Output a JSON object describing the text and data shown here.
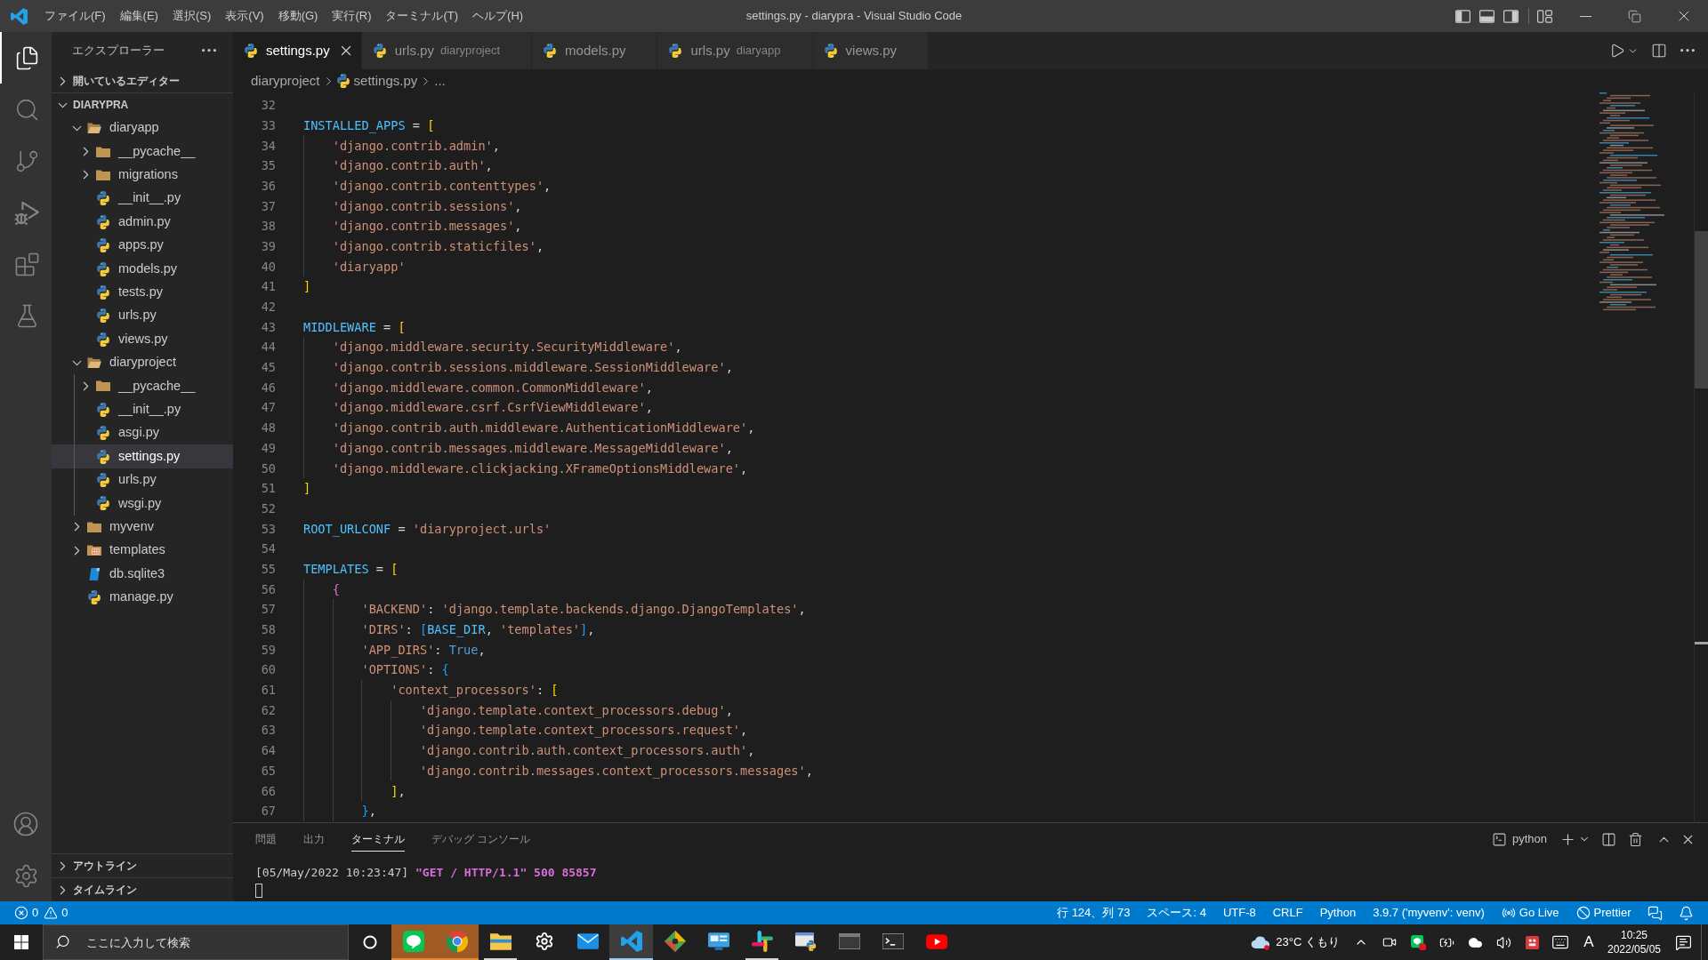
{
  "window": {
    "title": "settings.py - diarypra - Visual Studio Code"
  },
  "menu": [
    "ファイル(F)",
    "編集(E)",
    "選択(S)",
    "表示(V)",
    "移動(G)",
    "実行(R)",
    "ターミナル(T)",
    "ヘルプ(H)"
  ],
  "activity_bar": {
    "items": [
      {
        "kind": "explorer",
        "selected": true
      },
      {
        "kind": "search",
        "selected": false
      },
      {
        "kind": "source-control",
        "selected": false
      },
      {
        "kind": "run-debug",
        "selected": false
      },
      {
        "kind": "extensions",
        "selected": false
      },
      {
        "kind": "testing",
        "selected": false
      }
    ]
  },
  "sidebar": {
    "title": "エクスプローラー",
    "sections": [
      {
        "title": "開いているエディター",
        "expanded": false
      },
      {
        "title": "DIARYPRA",
        "expanded": true,
        "children": [
          {
            "label": "diaryapp",
            "kind": "folder",
            "expanded": true,
            "selected": false,
            "children": [
              {
                "label": "__pycache__",
                "kind": "folder",
                "expanded": false,
                "selected": false
              },
              {
                "label": "migrations",
                "kind": "folder",
                "expanded": false,
                "selected": false
              },
              {
                "label": "__init__.py",
                "kind": "python",
                "selected": false
              },
              {
                "label": "admin.py",
                "kind": "python",
                "selected": false
              },
              {
                "label": "apps.py",
                "kind": "python",
                "selected": false
              },
              {
                "label": "models.py",
                "kind": "python",
                "selected": false
              },
              {
                "label": "tests.py",
                "kind": "python",
                "selected": false
              },
              {
                "label": "urls.py",
                "kind": "python",
                "selected": false
              },
              {
                "label": "views.py",
                "kind": "python",
                "selected": false
              }
            ]
          },
          {
            "label": "diaryproject",
            "kind": "folder",
            "expanded": true,
            "selected": false,
            "children": [
              {
                "label": "__pycache__",
                "kind": "folder",
                "expanded": false,
                "selected": false
              },
              {
                "label": "__init__.py",
                "kind": "python",
                "selected": false
              },
              {
                "label": "asgi.py",
                "kind": "python",
                "selected": false
              },
              {
                "label": "settings.py",
                "kind": "python",
                "selected": true
              },
              {
                "label": "urls.py",
                "kind": "python",
                "selected": false
              },
              {
                "label": "wsgi.py",
                "kind": "python",
                "selected": false
              }
            ]
          },
          {
            "label": "myvenv",
            "kind": "folder",
            "expanded": false,
            "selected": false
          },
          {
            "label": "templates",
            "kind": "template-folder",
            "expanded": false,
            "selected": false
          },
          {
            "label": "db.sqlite3",
            "kind": "database",
            "selected": false
          },
          {
            "label": "manage.py",
            "kind": "python",
            "selected": false
          }
        ]
      },
      {
        "title": "アウトライン",
        "expanded": false
      },
      {
        "title": "タイムライン",
        "expanded": false
      }
    ]
  },
  "tabs": [
    {
      "label": "settings.py",
      "selected": true
    },
    {
      "label": "urls.py",
      "description": "diaryproject",
      "selected": false
    },
    {
      "label": "models.py",
      "selected": false
    },
    {
      "label": "urls.py",
      "description": "diaryapp",
      "selected": false
    },
    {
      "label": "views.py",
      "selected": false
    }
  ],
  "breadcrumbs": [
    {
      "label": "diaryproject",
      "kind": "folder"
    },
    {
      "label": "settings.py",
      "kind": "python"
    },
    {
      "label": "...",
      "kind": "symbol"
    }
  ],
  "editor": {
    "lines": [
      {
        "number": "32"
      },
      {
        "number": "33",
        "tokens": [
          {
            "kind": "constant",
            "text": "INSTALLED_APPS"
          },
          {
            "kind": "punct",
            "text": " = "
          },
          {
            "kind": "open",
            "text": "["
          }
        ]
      },
      {
        "number": "34",
        "tokens": [
          {
            "kind": "string",
            "text": "    'django.contrib.admin'"
          },
          {
            "kind": "punct",
            "text": ","
          }
        ]
      },
      {
        "number": "35",
        "tokens": [
          {
            "kind": "string",
            "text": "    'django.contrib.auth'"
          },
          {
            "kind": "punct",
            "text": ","
          }
        ]
      },
      {
        "number": "36",
        "tokens": [
          {
            "kind": "string",
            "text": "    'django.contrib.contenttypes'"
          },
          {
            "kind": "punct",
            "text": ","
          }
        ]
      },
      {
        "number": "37",
        "tokens": [
          {
            "kind": "string",
            "text": "    'django.contrib.sessions'"
          },
          {
            "kind": "punct",
            "text": ","
          }
        ]
      },
      {
        "number": "38",
        "tokens": [
          {
            "kind": "string",
            "text": "    'django.contrib.messages'"
          },
          {
            "kind": "punct",
            "text": ","
          }
        ]
      },
      {
        "number": "39",
        "tokens": [
          {
            "kind": "string",
            "text": "    'django.contrib.staticfiles'"
          },
          {
            "kind": "punct",
            "text": ","
          }
        ]
      },
      {
        "number": "40",
        "tokens": [
          {
            "kind": "string",
            "text": "    'diaryapp'"
          }
        ]
      },
      {
        "number": "41",
        "tokens": [
          {
            "kind": "close",
            "text": "]"
          }
        ]
      },
      {
        "number": "42"
      },
      {
        "number": "43",
        "tokens": [
          {
            "kind": "constant",
            "text": "MIDDLEWARE"
          },
          {
            "kind": "punct",
            "text": " = "
          },
          {
            "kind": "open",
            "text": "["
          }
        ]
      },
      {
        "number": "44",
        "tokens": [
          {
            "kind": "string",
            "text": "    'django.middleware.security.SecurityMiddleware'"
          },
          {
            "kind": "punct",
            "text": ","
          }
        ]
      },
      {
        "number": "45",
        "tokens": [
          {
            "kind": "string",
            "text": "    'django.contrib.sessions.middleware.SessionMiddleware'"
          },
          {
            "kind": "punct",
            "text": ","
          }
        ]
      },
      {
        "number": "46",
        "tokens": [
          {
            "kind": "string",
            "text": "    'django.middleware.common.CommonMiddleware'"
          },
          {
            "kind": "punct",
            "text": ","
          }
        ]
      },
      {
        "number": "47",
        "tokens": [
          {
            "kind": "string",
            "text": "    'django.middleware.csrf.CsrfViewMiddleware'"
          },
          {
            "kind": "punct",
            "text": ","
          }
        ]
      },
      {
        "number": "48",
        "tokens": [
          {
            "kind": "string",
            "text": "    'django.contrib.auth.middleware.AuthenticationMiddleware'"
          },
          {
            "kind": "punct",
            "text": ","
          }
        ]
      },
      {
        "number": "49",
        "tokens": [
          {
            "kind": "string",
            "text": "    'django.contrib.messages.middleware.MessageMiddleware'"
          },
          {
            "kind": "punct",
            "text": ","
          }
        ]
      },
      {
        "number": "50",
        "tokens": [
          {
            "kind": "string",
            "text": "    'django.middleware.clickjacking.XFrameOptionsMiddleware'"
          },
          {
            "kind": "punct",
            "text": ","
          }
        ]
      },
      {
        "number": "51",
        "tokens": [
          {
            "kind": "close",
            "text": "]"
          }
        ]
      },
      {
        "number": "52"
      },
      {
        "number": "53",
        "tokens": [
          {
            "kind": "constant",
            "text": "ROOT_URLCONF"
          },
          {
            "kind": "punct",
            "text": " = "
          },
          {
            "kind": "string",
            "text": "'diaryproject.urls'"
          }
        ]
      },
      {
        "number": "54"
      },
      {
        "number": "55",
        "tokens": [
          {
            "kind": "constant",
            "text": "TEMPLATES"
          },
          {
            "kind": "punct",
            "text": " = "
          },
          {
            "kind": "open",
            "text": "["
          }
        ]
      },
      {
        "number": "56",
        "tokens": [
          {
            "kind": "open",
            "text": "    {"
          }
        ]
      },
      {
        "number": "57",
        "tokens": [
          {
            "kind": "string",
            "text": "        'BACKEND'"
          },
          {
            "kind": "punct",
            "text": ": "
          },
          {
            "kind": "string",
            "text": "'django.template.backends.django.DjangoTemplates'"
          },
          {
            "kind": "punct",
            "text": ","
          }
        ]
      },
      {
        "number": "58",
        "tokens": [
          {
            "kind": "string",
            "text": "        'DIRS'"
          },
          {
            "kind": "punct",
            "text": ": "
          },
          {
            "kind": "open",
            "text": "["
          },
          {
            "kind": "constant",
            "text": "BASE_DIR"
          },
          {
            "kind": "punct",
            "text": ", "
          },
          {
            "kind": "string",
            "text": "'templates'"
          },
          {
            "kind": "close",
            "text": "]"
          },
          {
            "kind": "punct",
            "text": ","
          }
        ]
      },
      {
        "number": "59",
        "tokens": [
          {
            "kind": "string",
            "text": "        'APP_DIRS'"
          },
          {
            "kind": "punct",
            "text": ": "
          },
          {
            "kind": "keyword",
            "text": "True"
          },
          {
            "kind": "punct",
            "text": ","
          }
        ]
      },
      {
        "number": "60",
        "tokens": [
          {
            "kind": "string",
            "text": "        'OPTIONS'"
          },
          {
            "kind": "punct",
            "text": ": "
          },
          {
            "kind": "open",
            "text": "{"
          }
        ]
      },
      {
        "number": "61",
        "tokens": [
          {
            "kind": "string",
            "text": "            'context_processors'"
          },
          {
            "kind": "punct",
            "text": ": "
          },
          {
            "kind": "open",
            "text": "["
          }
        ]
      },
      {
        "number": "62",
        "tokens": [
          {
            "kind": "string",
            "text": "                'django.template.context_processors.debug'"
          },
          {
            "kind": "punct",
            "text": ","
          }
        ]
      },
      {
        "number": "63",
        "tokens": [
          {
            "kind": "string",
            "text": "                'django.template.context_processors.request'"
          },
          {
            "kind": "punct",
            "text": ","
          }
        ]
      },
      {
        "number": "64",
        "tokens": [
          {
            "kind": "string",
            "text": "                'django.contrib.auth.context_processors.auth'"
          },
          {
            "kind": "punct",
            "text": ","
          }
        ]
      },
      {
        "number": "65",
        "tokens": [
          {
            "kind": "string",
            "text": "                'django.contrib.messages.context_processors.messages'"
          },
          {
            "kind": "punct",
            "text": ","
          }
        ]
      },
      {
        "number": "66",
        "tokens": [
          {
            "kind": "close",
            "text": "            ]"
          },
          {
            "kind": "punct",
            "text": ","
          }
        ]
      },
      {
        "number": "67",
        "tokens": [
          {
            "kind": "close",
            "text": "        }"
          },
          {
            "kind": "punct",
            "text": ","
          }
        ]
      }
    ]
  },
  "panel": {
    "tabs": [
      {
        "label": "問題",
        "selected": false
      },
      {
        "label": "出力",
        "selected": false
      },
      {
        "label": "ターミナル",
        "selected": true
      },
      {
        "label": "デバッグ コンソール",
        "selected": false
      }
    ],
    "terminal_profile": "python",
    "terminal": {
      "lines": [
        {
          "segments": [
            {
              "kind": "plain",
              "text": "[05/May/2022 10:23:47] "
            },
            {
              "kind": "magenta",
              "text": "\"GET / HTTP/1.1\" 500 85857"
            }
          ]
        }
      ]
    }
  },
  "status_bar": {
    "problems": {
      "errors": "0",
      "warnings": "0"
    },
    "items": [
      {
        "kind": "text",
        "label": "行 124、列 73"
      },
      {
        "kind": "text",
        "label": "スペース: 4"
      },
      {
        "kind": "text",
        "label": "UTF-8"
      },
      {
        "kind": "text",
        "label": "CRLF"
      },
      {
        "kind": "text",
        "label": "Python"
      },
      {
        "kind": "text",
        "label": "3.9.7 ('myvenv': venv)"
      },
      {
        "kind": "live",
        "label": "Go Live"
      },
      {
        "kind": "prettier",
        "label": "Prettier"
      }
    ]
  },
  "taskbar": {
    "search": {
      "placeholder": "ここに入力して検索"
    },
    "apps": [
      {
        "kind": "chat",
        "flashing": true,
        "selected": false,
        "running": true
      },
      {
        "kind": "browser",
        "flashing": true,
        "selected": false,
        "running": true
      },
      {
        "kind": "files",
        "flashing": false,
        "selected": false,
        "running": true
      },
      {
        "kind": "gear",
        "flashing": false,
        "selected": false,
        "running": false
      },
      {
        "kind": "mail",
        "flashing": false,
        "selected": false,
        "running": false
      },
      {
        "kind": "code",
        "flashing": false,
        "selected": true,
        "running": true
      },
      {
        "kind": "diamond",
        "flashing": false,
        "selected": false,
        "running": false
      },
      {
        "kind": "monitor",
        "flashing": false,
        "selected": false,
        "running": false
      },
      {
        "kind": "hash",
        "flashing": false,
        "selected": false,
        "running": true
      },
      {
        "kind": "python",
        "flashing": false,
        "selected": false,
        "running": false
      },
      {
        "kind": "window",
        "flashing": false,
        "selected": false,
        "running": false
      },
      {
        "kind": "prompt",
        "flashing": false,
        "selected": false,
        "running": false
      },
      {
        "kind": "video",
        "flashing": false,
        "selected": false,
        "running": false
      }
    ],
    "weather": "23°C くもり",
    "input_mode": "A",
    "time": "10:25",
    "date": "2022/05/05"
  }
}
